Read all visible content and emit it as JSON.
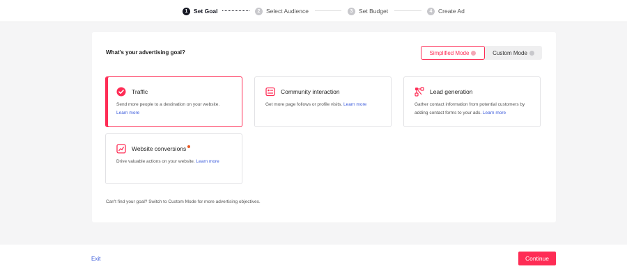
{
  "stepper": {
    "steps": [
      {
        "num": "1",
        "label": "Set Goal"
      },
      {
        "num": "2",
        "label": "Select Audience"
      },
      {
        "num": "3",
        "label": "Set Budget"
      },
      {
        "num": "4",
        "label": "Create Ad"
      }
    ]
  },
  "main": {
    "question": "What's your advertising goal?",
    "modes": {
      "simplified": "Simplified Mode",
      "custom": "Custom Mode"
    },
    "goals": [
      {
        "title": "Traffic",
        "desc": "Send more people to a destination on your website.",
        "learn": "Learn more",
        "icon": "check-circle-icon",
        "selected": true
      },
      {
        "title": "Community interaction",
        "desc": "Get more page follows or profile visits.",
        "learn": "Learn more",
        "icon": "community-icon"
      },
      {
        "title": "Lead generation",
        "desc": "Gather contact information from potential customers by adding contact forms to your ads.",
        "learn": "Learn more",
        "icon": "lead-icon"
      },
      {
        "title": "Website conversions",
        "desc": "Drive valuable actions on your website.",
        "learn": "Learn more",
        "icon": "conversion-chart-icon"
      }
    ],
    "hint": "Can't find your goal? Switch to Custom Mode for more advertising objectives."
  },
  "footer": {
    "exit": "Exit",
    "continue": "Continue"
  },
  "colors": {
    "accent": "#fe2c55",
    "link": "#3b5bdb",
    "new_dot": "#e85a24"
  }
}
